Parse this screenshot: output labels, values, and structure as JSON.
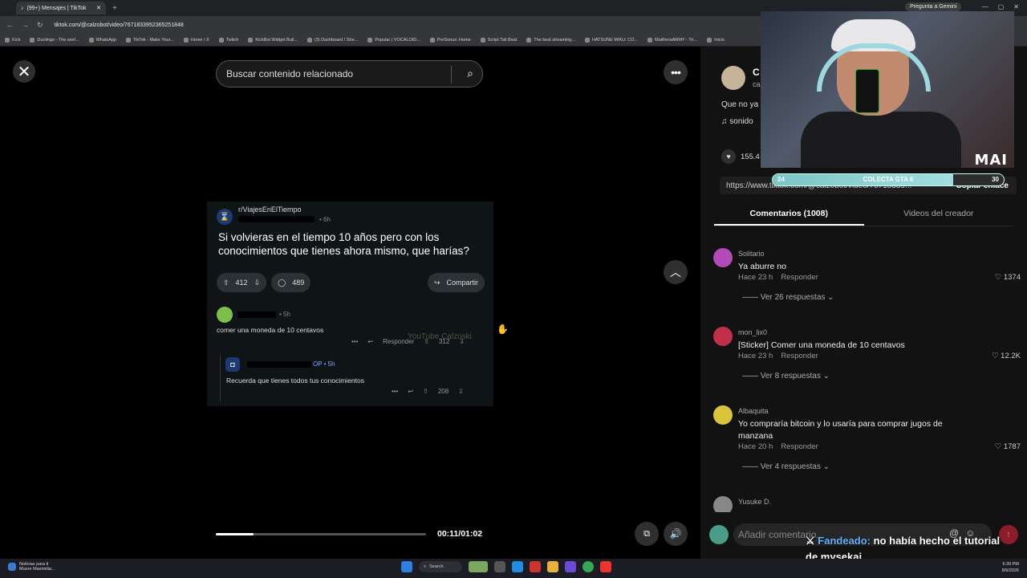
{
  "browser": {
    "tab_title": "(99+) Mensajes | TikTok",
    "url": "tiktok.com/@calzobot/video/7671833952365251848",
    "gemini_label": "Pregunta a Gemini",
    "bookmarks": [
      "Kick",
      "Duolingo - The worl...",
      "WhatsApp",
      "TikTok - Make Your...",
      "Home / X",
      "Twitch",
      "KickBot Widget Buil...",
      "(3) Dashboard / Stre...",
      "Popular | VOCALOID...",
      "PreSonus: Home",
      "Script Tail Beat",
      "The best streaming...",
      "HATSUNE MIKU: CO...",
      "MaiRensARMY - Tri...",
      "Inicio"
    ]
  },
  "video": {
    "search_placeholder": "Buscar contenido relacionado",
    "post": {
      "subreddit": "r/ViajesEnElTiempo",
      "time": "• 6h",
      "title": "Si volvieras en el tiempo 10 años pero con los conocimientos que tienes ahora mismo, que harías?",
      "upvotes": "412",
      "comments": "489",
      "share_label": "Compartir"
    },
    "comment1": {
      "time": "• 5h",
      "text": "comer una moneda de 10 centavos",
      "more": "•••",
      "reply_label": "Responder",
      "votes": "312"
    },
    "watermark": "YouTube Calzoski",
    "comment2": {
      "op_label": "OP",
      "time": "• 5h",
      "text": "Recuerda que tienes todos tus conocimientos",
      "more": "•••",
      "votes": "208"
    },
    "progress_fraction": 0.18,
    "timecode": "00:11/01:02"
  },
  "controls": {
    "close_glyph": "✕",
    "more_glyph": "•••",
    "up_glyph": "︿",
    "pip_glyph": "⧉",
    "volume_glyph": "🔊"
  },
  "panel": {
    "creator_name": "C",
    "creator_handle": "ca",
    "description": "Que no ya",
    "music": "♫  sonido",
    "likes": "155.4",
    "link": "https://www.tiktok.com/@calzobot/video/76718339...",
    "copy_link": "Copiar enlace",
    "tabs": [
      "Comentarios (1008)",
      "Videos del creador"
    ],
    "comments": [
      {
        "name": "Solitario",
        "text": "Ya aburre no",
        "time": "Hace 23 h",
        "reply": "Responder",
        "likes": "1374",
        "replies": "Ver 26 respuestas",
        "avatar_color": "#b34ab8"
      },
      {
        "name": "mon_lix0",
        "text": "[Sticker] Comer una moneda de 10 centavos",
        "time": "Hace 23 h",
        "reply": "Responder",
        "likes": "12.2K",
        "replies": "Ver 8 respuestas",
        "avatar_color": "#c0304a"
      },
      {
        "name": "Albaquita",
        "text": "Yo compraría bitcoin y lo usaría para comprar jugos de manzana",
        "time": "Hace 20 h",
        "reply": "Responder",
        "likes": "1787",
        "replies": "Ver 4 respuestas",
        "avatar_color": "#d9c33b"
      },
      {
        "name": "Yusuke D.",
        "text": "",
        "time": "",
        "reply": "",
        "likes": "",
        "replies": "",
        "avatar_color": "#888888"
      }
    ],
    "add_comment_placeholder": "Añadir comentario..."
  },
  "stream_overlay": {
    "label": "MAI",
    "goal_label": "COLECTA GTA 6",
    "goal_min": "24",
    "goal_max": "30",
    "goal_fraction": 0.78,
    "chat_user": "Fandeado:",
    "chat_message": "no había hecho el tutorial de mysekai"
  },
  "taskbar": {
    "news_title": "Noticias para ti",
    "news_sub": "Muere Maximilia...",
    "search_label": "Search",
    "time": "6:39 PM",
    "date": "8/9/2026"
  }
}
